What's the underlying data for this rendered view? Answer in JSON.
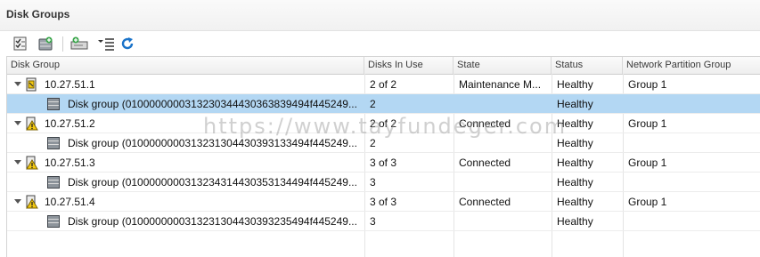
{
  "panel": {
    "title": "Disk Groups"
  },
  "toolbar": {
    "buttons": [
      {
        "name": "claim-disks-icon"
      },
      {
        "name": "create-disk-group-icon"
      },
      {
        "name": "add-disk-icon"
      },
      {
        "name": "list-options-icon"
      },
      {
        "name": "refresh-icon"
      }
    ]
  },
  "columns": [
    "Disk Group",
    "Disks In Use",
    "State",
    "Status",
    "Network Partition Group"
  ],
  "rows": [
    {
      "type": "host",
      "name": "10.27.51.1",
      "disks": "2 of 2",
      "state": "Maintenance M...",
      "status": "Healthy",
      "partition": "Group 1",
      "icon": "host-maintenance-icon"
    },
    {
      "type": "group",
      "name": "Disk group (0100000000313230344430363839494f445249...",
      "disks": "2",
      "state": "",
      "status": "Healthy",
      "partition": "",
      "selected": true
    },
    {
      "type": "host",
      "name": "10.27.51.2",
      "disks": "2 of 2",
      "state": "Connected",
      "status": "Healthy",
      "partition": "Group 1",
      "icon": "host-warning-icon"
    },
    {
      "type": "group",
      "name": "Disk group (0100000000313231304430393133494f445249...",
      "disks": "2",
      "state": "",
      "status": "Healthy",
      "partition": ""
    },
    {
      "type": "host",
      "name": "10.27.51.3",
      "disks": "3 of 3",
      "state": "Connected",
      "status": "Healthy",
      "partition": "Group 1",
      "icon": "host-warning-icon"
    },
    {
      "type": "group",
      "name": "Disk group (0100000000313234314430353134494f445249...",
      "disks": "3",
      "state": "",
      "status": "Healthy",
      "partition": ""
    },
    {
      "type": "host",
      "name": "10.27.51.4",
      "disks": "3 of 3",
      "state": "Connected",
      "status": "Healthy",
      "partition": "Group 1",
      "icon": "host-warning-icon"
    },
    {
      "type": "group",
      "name": "Disk group (0100000000313231304430393235494f445249...",
      "disks": "3",
      "state": "",
      "status": "Healthy",
      "partition": ""
    }
  ],
  "watermark": "https://www.tayfundeger.com",
  "colors": {
    "selected_row": "#b3d7f3",
    "refresh": "#1a73c9",
    "warning": "#f2c811"
  }
}
